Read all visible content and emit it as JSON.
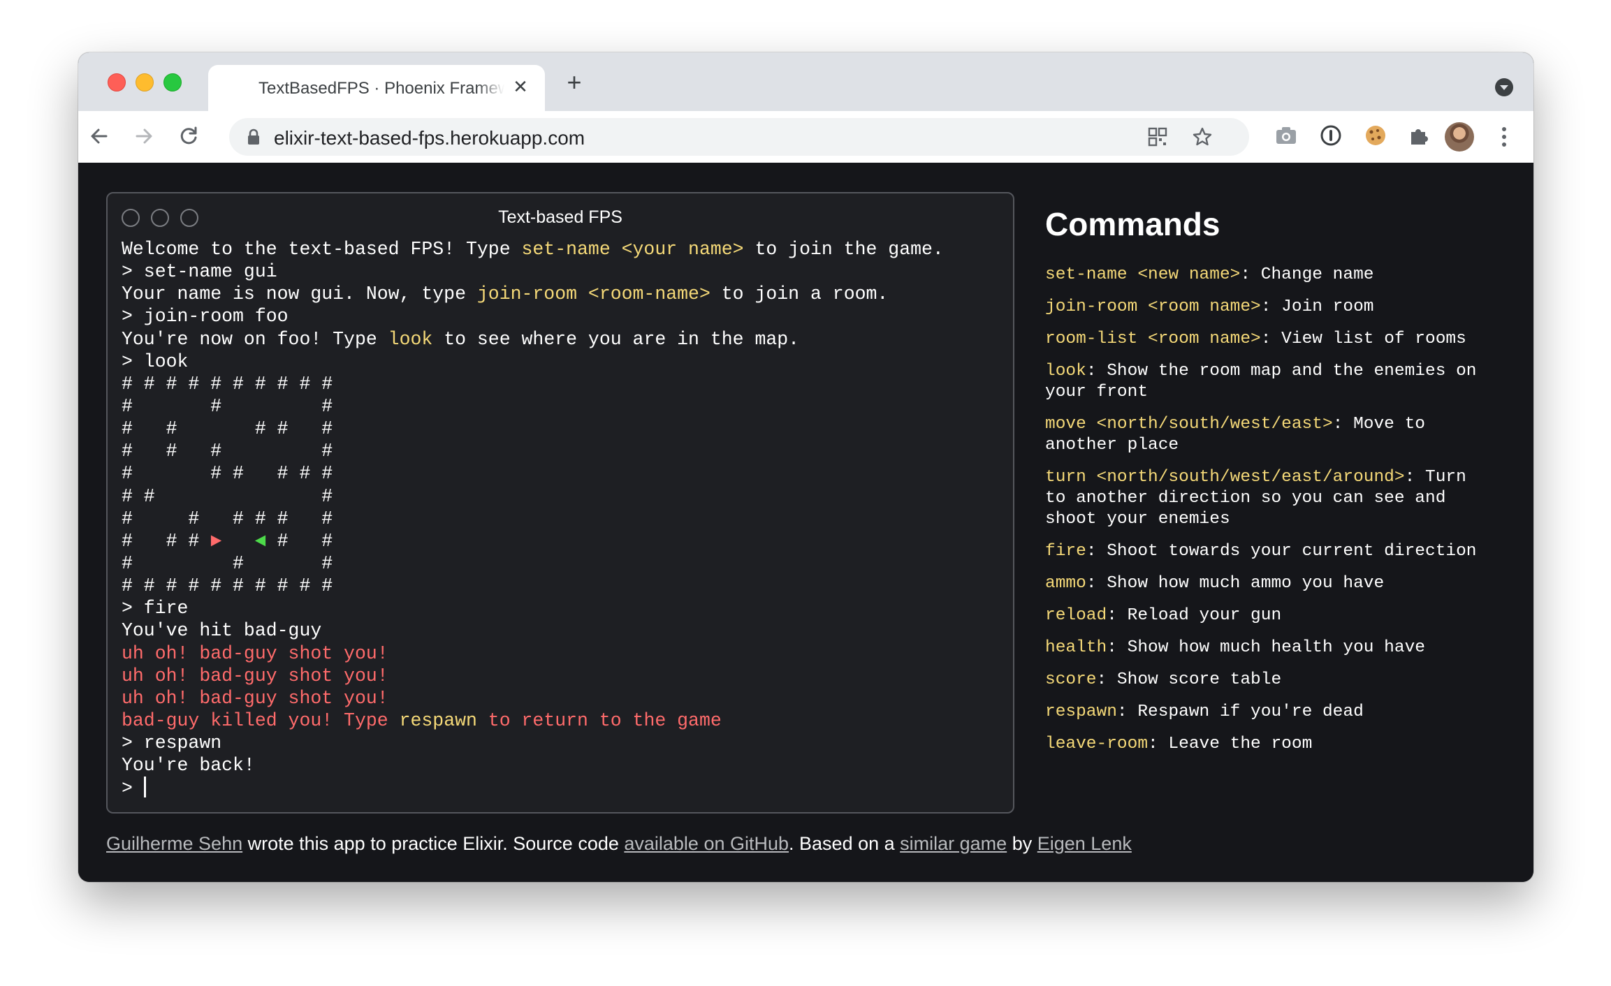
{
  "browser": {
    "tab_title": "TextBasedFPS · Phoenix Framework",
    "url": "elixir-text-based-fps.herokuapp.com",
    "new_tab_symbol": "+",
    "tab_close_symbol": "✕"
  },
  "terminal": {
    "title": "Text-based FPS",
    "lines": [
      [
        {
          "t": "Welcome to the text-based FPS! Type "
        },
        {
          "t": "set-name <your name>",
          "c": "hl"
        },
        {
          "t": " to join the game."
        }
      ],
      [
        {
          "t": "> set-name gui"
        }
      ],
      [
        {
          "t": "Your name is now gui. Now, type "
        },
        {
          "t": "join-room <room-name>",
          "c": "hl"
        },
        {
          "t": " to join a room."
        }
      ],
      [
        {
          "t": "> join-room foo"
        }
      ],
      [
        {
          "t": "You're now on foo! Type "
        },
        {
          "t": "look",
          "c": "hl"
        },
        {
          "t": " to see where you are in the map."
        }
      ],
      [
        {
          "t": "> look"
        }
      ],
      [
        {
          "t": "# # # # # # # # # #"
        }
      ],
      [
        {
          "t": "#       #         #"
        }
      ],
      [
        {
          "t": "#   #       # #   #"
        }
      ],
      [
        {
          "t": "#   #   #         #"
        }
      ],
      [
        {
          "t": "#       # #   # # #"
        }
      ],
      [
        {
          "t": "# #               #"
        }
      ],
      [
        {
          "t": "#     #   # # #   #"
        }
      ],
      [
        {
          "t": "#   # # "
        },
        {
          "t": "►",
          "c": "p-red"
        },
        {
          "t": "   "
        },
        {
          "t": "◄",
          "c": "p-green"
        },
        {
          "t": " #   #"
        }
      ],
      [
        {
          "t": "#         #       #"
        }
      ],
      [
        {
          "t": "# # # # # # # # # #"
        }
      ],
      [
        {
          "t": "> fire"
        }
      ],
      [
        {
          "t": "You've hit bad-guy"
        }
      ],
      [
        {
          "t": "uh oh! bad-guy shot you!",
          "c": "err"
        }
      ],
      [
        {
          "t": "uh oh! bad-guy shot you!",
          "c": "err"
        }
      ],
      [
        {
          "t": "uh oh! bad-guy shot you!",
          "c": "err"
        }
      ],
      [
        {
          "t": "bad-guy killed you! Type ",
          "c": "err"
        },
        {
          "t": "respawn",
          "c": "hl"
        },
        {
          "t": " to return to the game",
          "c": "err"
        }
      ],
      [
        {
          "t": "> respawn"
        }
      ],
      [
        {
          "t": "You're back!"
        }
      ]
    ],
    "prompt": "> "
  },
  "commands": {
    "heading": "Commands",
    "items": [
      {
        "name": "set-name <new name>",
        "desc": ": Change name"
      },
      {
        "name": "join-room <room name>",
        "desc": ": Join room"
      },
      {
        "name": "room-list <room name>",
        "desc": ": View list of rooms"
      },
      {
        "name": "look",
        "desc": ": Show the room map and the enemies on your front"
      },
      {
        "name": "move <north/south/west/east>",
        "desc": ": Move to another place"
      },
      {
        "name": "turn <north/south/west/east/around>",
        "desc": ": Turn to another direction so you can see and shoot your enemies"
      },
      {
        "name": "fire",
        "desc": ": Shoot towards your current direction"
      },
      {
        "name": "ammo",
        "desc": ": Show how much ammo you have"
      },
      {
        "name": "reload",
        "desc": ": Reload your gun"
      },
      {
        "name": "health",
        "desc": ": Show how much health you have"
      },
      {
        "name": "score",
        "desc": ": Show score table"
      },
      {
        "name": "respawn",
        "desc": ": Respawn if you're dead"
      },
      {
        "name": "leave-room",
        "desc": ": Leave the room"
      }
    ]
  },
  "footer": {
    "author_link": "Guilherme Sehn",
    "text1": " wrote this app to practice Elixir. Source code ",
    "source_link": "available on GitHub",
    "text2": ". Based on a ",
    "similar_link": "similar game",
    "text3": " by ",
    "eigen_link": "Eigen Lenk"
  },
  "icons": {
    "back": "arrow-left-icon",
    "forward": "arrow-right-icon",
    "reload": "reload-icon",
    "lock": "lock-icon",
    "qr": "qr-code-icon",
    "bookmark": "star-icon",
    "camera": "camera-icon",
    "password": "password-manager-icon",
    "cookie": "cookie-icon",
    "extensions": "puzzle-icon",
    "profile": "avatar",
    "menu": "kebab-menu-icon"
  },
  "colors": {
    "highlight": "#f5d978",
    "error": "#ff6b6b",
    "player": "#ff6b6b",
    "enemy": "#4ddb4a",
    "page_bg": "#15161a",
    "terminal_bg": "#1e1f23"
  }
}
